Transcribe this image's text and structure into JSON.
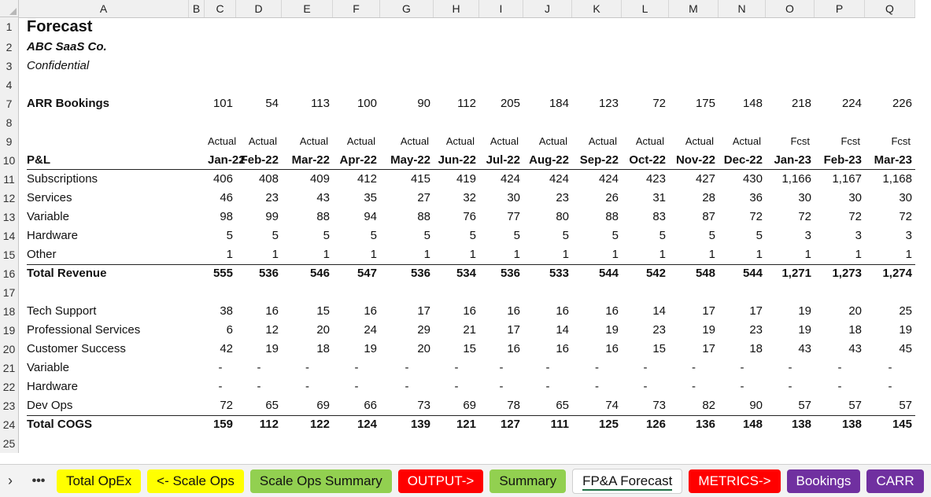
{
  "columns": [
    "A",
    "B",
    "C",
    "D",
    "E",
    "F",
    "G",
    "H",
    "I",
    "J",
    "K",
    "L",
    "M",
    "N",
    "O",
    "P",
    "Q"
  ],
  "title": "Forecast",
  "company": "ABC SaaS Co.",
  "confidentiality": "Confidential",
  "arr_label": "ARR Bookings",
  "arr_values": [
    "101",
    "54",
    "113",
    "100",
    "90",
    "112",
    "205",
    "184",
    "123",
    "72",
    "175",
    "148",
    "218",
    "224",
    "226"
  ],
  "period_types": [
    "Actual",
    "Actual",
    "Actual",
    "Actual",
    "Actual",
    "Actual",
    "Actual",
    "Actual",
    "Actual",
    "Actual",
    "Actual",
    "Actual",
    "Fcst",
    "Fcst",
    "Fcst"
  ],
  "pl_label": "P&L",
  "months": [
    "Jan-22",
    "Feb-22",
    "Mar-22",
    "Apr-22",
    "May-22",
    "Jun-22",
    "Jul-22",
    "Aug-22",
    "Sep-22",
    "Oct-22",
    "Nov-22",
    "Dec-22",
    "Jan-23",
    "Feb-23",
    "Mar-23"
  ],
  "rows": [
    {
      "num": "1"
    },
    {
      "num": "2"
    },
    {
      "num": "3"
    },
    {
      "num": "4"
    },
    {
      "num": "7"
    },
    {
      "num": "8"
    },
    {
      "num": "9"
    },
    {
      "num": "10"
    },
    {
      "num": "11",
      "label": "Subscriptions",
      "values": [
        "406",
        "408",
        "409",
        "412",
        "415",
        "419",
        "424",
        "424",
        "424",
        "423",
        "427",
        "430",
        "1,166",
        "1,167",
        "1,168"
      ]
    },
    {
      "num": "12",
      "label": "Services",
      "values": [
        "46",
        "23",
        "43",
        "35",
        "27",
        "32",
        "30",
        "23",
        "26",
        "31",
        "28",
        "36",
        "30",
        "30",
        "30"
      ]
    },
    {
      "num": "13",
      "label": "Variable",
      "values": [
        "98",
        "99",
        "88",
        "94",
        "88",
        "76",
        "77",
        "80",
        "88",
        "83",
        "87",
        "72",
        "72",
        "72",
        "72"
      ]
    },
    {
      "num": "14",
      "label": "Hardware",
      "values": [
        "5",
        "5",
        "5",
        "5",
        "5",
        "5",
        "5",
        "5",
        "5",
        "5",
        "5",
        "5",
        "3",
        "3",
        "3"
      ]
    },
    {
      "num": "15",
      "label": "Other",
      "values": [
        "1",
        "1",
        "1",
        "1",
        "1",
        "1",
        "1",
        "1",
        "1",
        "1",
        "1",
        "1",
        "1",
        "1",
        "1"
      ]
    },
    {
      "num": "16",
      "label": "Total Revenue",
      "values": [
        "555",
        "536",
        "546",
        "547",
        "536",
        "534",
        "536",
        "533",
        "544",
        "542",
        "548",
        "544",
        "1,271",
        "1,273",
        "1,274"
      ]
    },
    {
      "num": "17"
    },
    {
      "num": "18",
      "label": "Tech Support",
      "values": [
        "38",
        "16",
        "15",
        "16",
        "17",
        "16",
        "16",
        "16",
        "16",
        "14",
        "17",
        "17",
        "19",
        "20",
        "25"
      ]
    },
    {
      "num": "19",
      "label": "Professional Services",
      "values": [
        "6",
        "12",
        "20",
        "24",
        "29",
        "21",
        "17",
        "14",
        "19",
        "23",
        "19",
        "23",
        "19",
        "18",
        "19"
      ]
    },
    {
      "num": "20",
      "label": "Customer Success",
      "values": [
        "42",
        "19",
        "18",
        "19",
        "20",
        "15",
        "16",
        "16",
        "16",
        "15",
        "17",
        "18",
        "43",
        "43",
        "45"
      ]
    },
    {
      "num": "21",
      "label": "Variable",
      "values": [
        "-",
        "-",
        "-",
        "-",
        "-",
        "-",
        "-",
        "-",
        "-",
        "-",
        "-",
        "-",
        "-",
        "-",
        "-"
      ]
    },
    {
      "num": "22",
      "label": "Hardware",
      "values": [
        "-",
        "-",
        "-",
        "-",
        "-",
        "-",
        "-",
        "-",
        "-",
        "-",
        "-",
        "-",
        "-",
        "-",
        "-"
      ]
    },
    {
      "num": "23",
      "label": "Dev Ops",
      "values": [
        "72",
        "65",
        "69",
        "66",
        "73",
        "69",
        "78",
        "65",
        "74",
        "73",
        "82",
        "90",
        "57",
        "57",
        "57"
      ]
    },
    {
      "num": "24",
      "label": "Total COGS",
      "values": [
        "159",
        "112",
        "122",
        "124",
        "139",
        "121",
        "127",
        "111",
        "125",
        "126",
        "136",
        "148",
        "138",
        "138",
        "145"
      ]
    },
    {
      "num": "25"
    }
  ],
  "tabs": [
    {
      "label": "Total OpEx",
      "color": "#ffff00"
    },
    {
      "label": "<- Scale Ops",
      "color": "#ffff00"
    },
    {
      "label": "Scale Ops Summary",
      "color": "#92d050"
    },
    {
      "label": "OUTPUT->",
      "color": "#ff0000"
    },
    {
      "label": "Summary",
      "color": "#92d050"
    },
    {
      "label": "FP&A Forecast",
      "color": "#ffffff",
      "active": true
    },
    {
      "label": "METRICS->",
      "color": "#ff0000"
    },
    {
      "label": "Bookings",
      "color": "#7030a0"
    },
    {
      "label": "CARR",
      "color": "#7030a0"
    }
  ],
  "nav_next": "›",
  "nav_more": "•••"
}
